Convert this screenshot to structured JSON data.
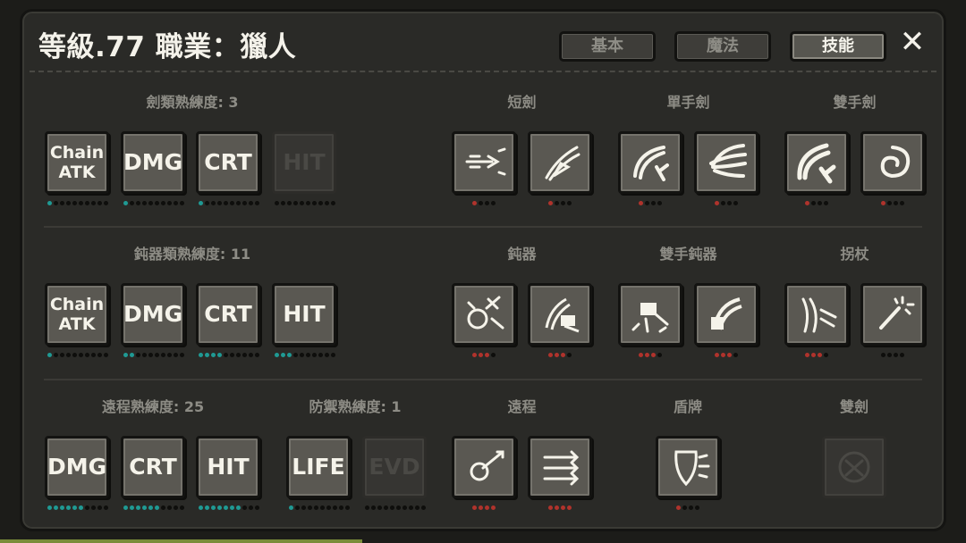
{
  "header": {
    "title": "等級.77 職業：獵人",
    "tabs": [
      {
        "label": "基本",
        "active": false
      },
      {
        "label": "魔法",
        "active": false
      },
      {
        "label": "技能",
        "active": true
      }
    ],
    "close_label": "✕"
  },
  "colors": {
    "progress_teal": "#1f9a94",
    "progress_red": "#b0332c",
    "panel": "#2a2a27"
  },
  "rows": [
    {
      "proficiency": {
        "label": "劍類熟練度: 3",
        "tiles": [
          {
            "text": "Chain ATK",
            "progress": 1,
            "max": 10,
            "locked": false
          },
          {
            "text": "DMG",
            "progress": 1,
            "max": 10,
            "locked": false
          },
          {
            "text": "CRT",
            "progress": 1,
            "max": 10,
            "locked": false
          },
          {
            "text": "HIT",
            "progress": 0,
            "max": 10,
            "locked": true
          }
        ]
      },
      "categories": [
        {
          "label": "短劍",
          "skills": [
            {
              "icon": "dagger-dash-icon",
              "progress": 1,
              "max": 4
            },
            {
              "icon": "dagger-slash-icon",
              "progress": 1,
              "max": 4
            }
          ]
        },
        {
          "label": "單手劍",
          "skills": [
            {
              "icon": "sword-swing-icon",
              "progress": 1,
              "max": 4
            },
            {
              "icon": "sword-wind-icon",
              "progress": 1,
              "max": 4
            }
          ]
        },
        {
          "label": "雙手劍",
          "skills": [
            {
              "icon": "greatsword-swing-icon",
              "progress": 1,
              "max": 4
            },
            {
              "icon": "whirlwind-icon",
              "progress": 1,
              "max": 4
            }
          ]
        }
      ]
    },
    {
      "proficiency": {
        "label": "鈍器類熟練度: 11",
        "tiles": [
          {
            "text": "Chain ATK",
            "progress": 1,
            "max": 10,
            "locked": false
          },
          {
            "text": "DMG",
            "progress": 2,
            "max": 10,
            "locked": false
          },
          {
            "text": "CRT",
            "progress": 4,
            "max": 10,
            "locked": false
          },
          {
            "text": "HIT",
            "progress": 3,
            "max": 10,
            "locked": false
          }
        ]
      },
      "categories": [
        {
          "label": "鈍器",
          "skills": [
            {
              "icon": "mace-stun-icon",
              "progress": 3,
              "max": 4
            },
            {
              "icon": "hammer-smash-icon",
              "progress": 3,
              "max": 4
            }
          ]
        },
        {
          "label": "雙手鈍器",
          "skills": [
            {
              "icon": "warhammer-quake-icon",
              "progress": 3,
              "max": 4
            },
            {
              "icon": "warhammer-swing-icon",
              "progress": 3,
              "max": 4
            }
          ]
        },
        {
          "label": "拐杖",
          "skills": [
            {
              "icon": "staff-strike-icon",
              "progress": 3,
              "max": 4
            },
            {
              "icon": "magic-wand-icon",
              "progress": 0,
              "max": 4
            }
          ]
        }
      ]
    },
    {
      "proficiency": {
        "label": "遠程熟練度: 25",
        "tiles": [
          {
            "text": "DMG",
            "progress": 6,
            "max": 10,
            "locked": false
          },
          {
            "text": "CRT",
            "progress": 6,
            "max": 10,
            "locked": false
          },
          {
            "text": "HIT",
            "progress": 7,
            "max": 10,
            "locked": false
          }
        ]
      },
      "defense": {
        "label": "防禦熟練度: 1",
        "tiles": [
          {
            "text": "LIFE",
            "progress": 1,
            "max": 10,
            "locked": false
          },
          {
            "text": "EVD",
            "progress": 0,
            "max": 10,
            "locked": true
          }
        ]
      },
      "categories": [
        {
          "label": "遠程",
          "skills": [
            {
              "icon": "arrow-hit-icon",
              "progress": 4,
              "max": 4
            },
            {
              "icon": "multi-arrow-icon",
              "progress": 4,
              "max": 4
            }
          ]
        },
        {
          "label": "盾牌",
          "skills": [
            {
              "icon": "shield-bash-icon",
              "progress": 1,
              "max": 4
            }
          ]
        },
        {
          "label": "雙劍",
          "skills": [
            {
              "icon": "dual-sword-icon",
              "progress": 0,
              "max": 4,
              "locked": true
            }
          ]
        }
      ]
    }
  ]
}
